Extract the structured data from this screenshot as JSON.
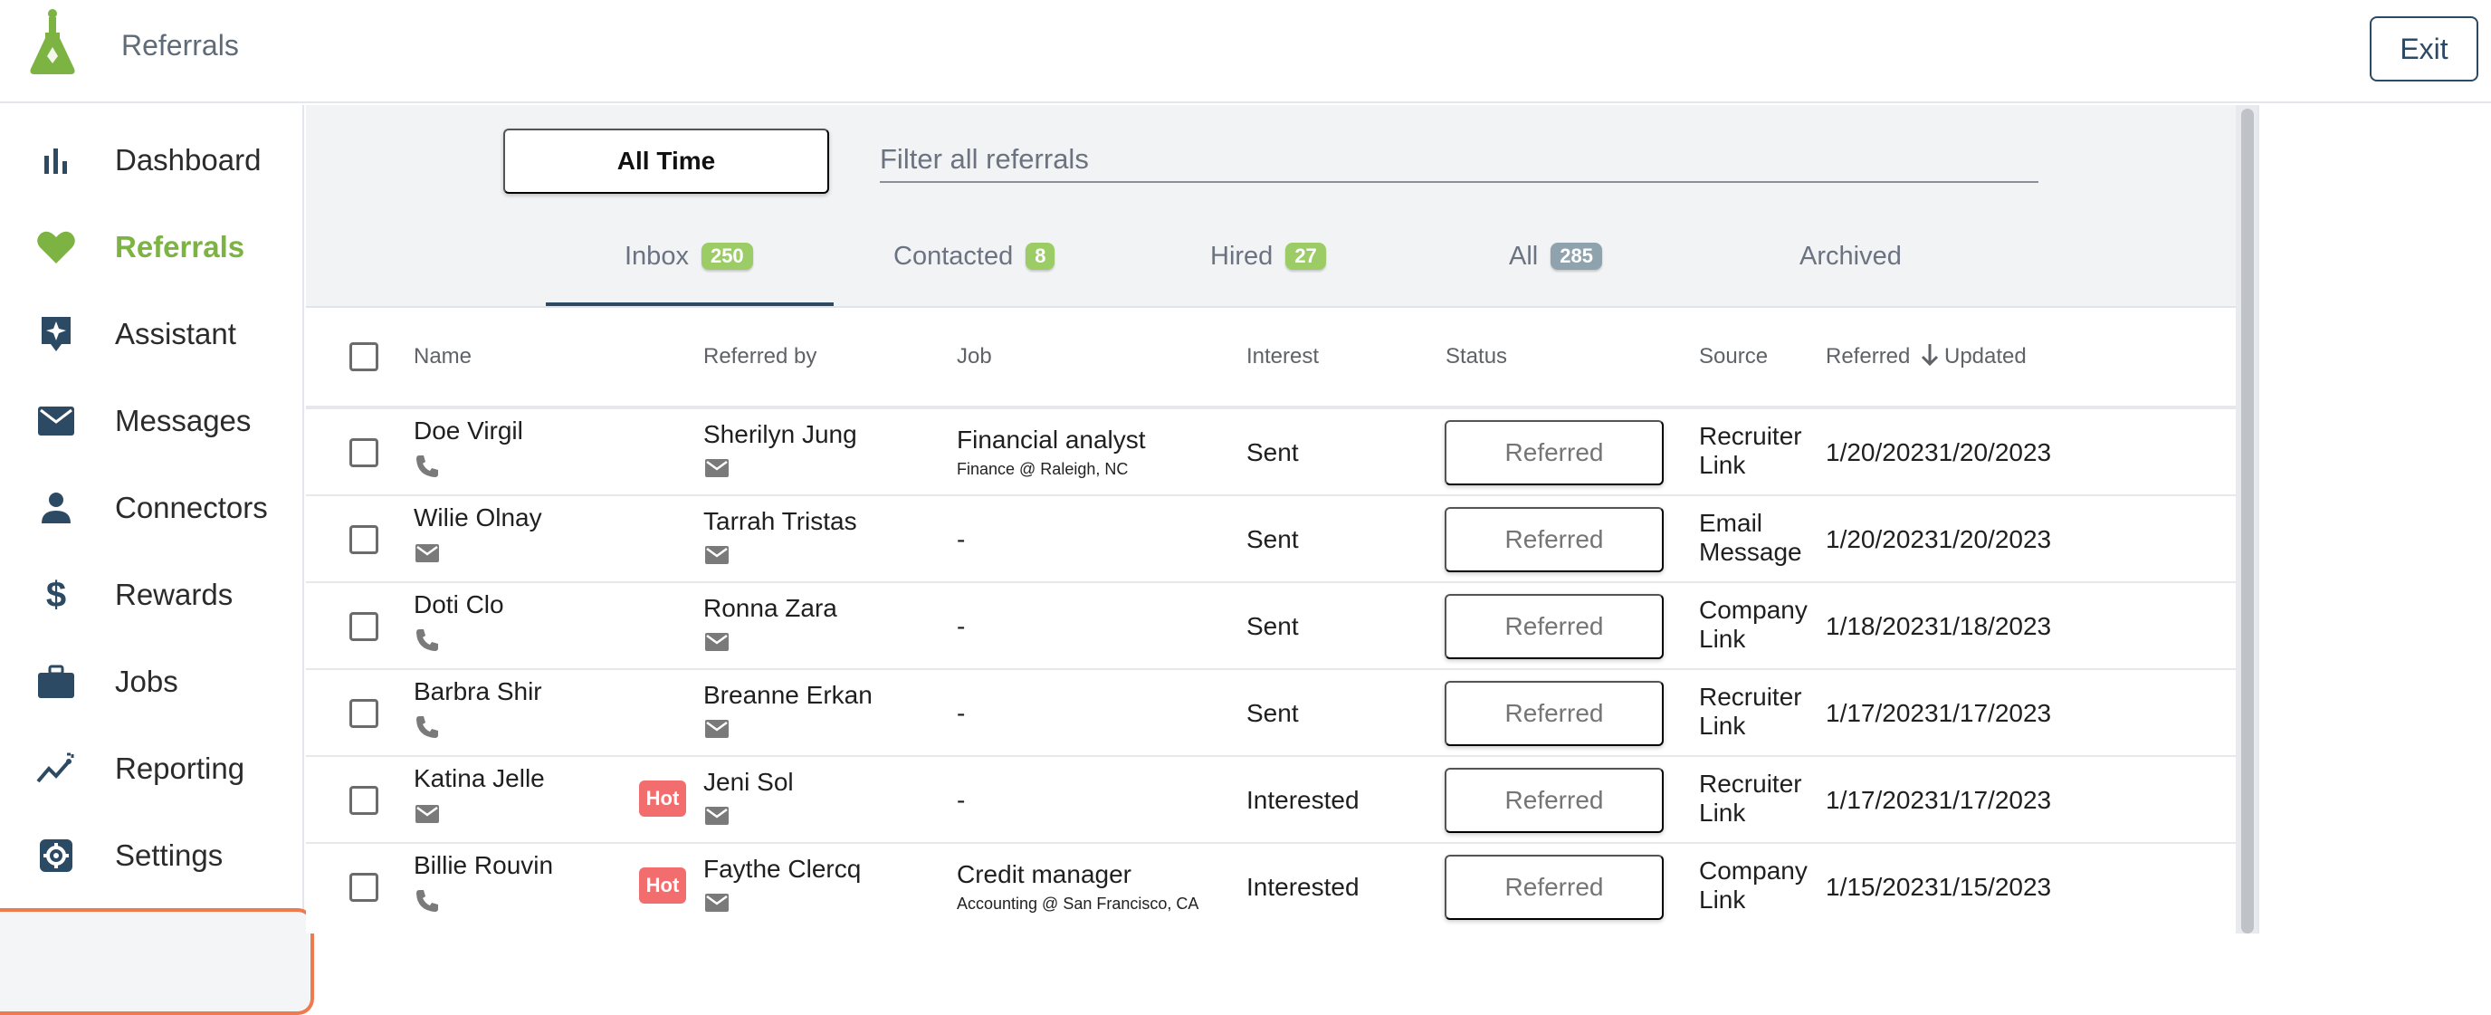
{
  "app": {
    "title": "Referrals",
    "exit_label": "Exit"
  },
  "colors": {
    "brand_green": "#7cb342",
    "navy": "#2c4a63",
    "hot_red": "#f26d6d",
    "highlight_orange": "#ef7a4e"
  },
  "sidebar": {
    "items": [
      {
        "label": "Dashboard",
        "icon": "bar-chart-icon"
      },
      {
        "label": "Referrals",
        "icon": "heart-icon",
        "active": true
      },
      {
        "label": "Assistant",
        "icon": "sparkle-icon"
      },
      {
        "label": "Messages",
        "icon": "envelope-icon"
      },
      {
        "label": "Connectors",
        "icon": "person-icon"
      },
      {
        "label": "Rewards",
        "icon": "dollar-icon"
      },
      {
        "label": "Jobs",
        "icon": "briefcase-icon"
      },
      {
        "label": "Reporting",
        "icon": "trend-icon"
      },
      {
        "label": "Settings",
        "icon": "gear-icon"
      }
    ]
  },
  "filters": {
    "time_label": "All Time",
    "search_placeholder": "Filter all referrals"
  },
  "tabs": [
    {
      "label": "Inbox",
      "count": "250"
    },
    {
      "label": "Contacted",
      "count": "8"
    },
    {
      "label": "Hired",
      "count": "27"
    },
    {
      "label": "All",
      "count": "285"
    },
    {
      "label": "Archived",
      "count": ""
    }
  ],
  "table": {
    "headers": {
      "name": "Name",
      "referred_by": "Referred by",
      "job": "Job",
      "interest": "Interest",
      "status": "Status",
      "source": "Source",
      "referred": "Referred",
      "updated": "Updated"
    },
    "rows": [
      {
        "name": "Doe Virgil",
        "contact_icon": "phone-icon",
        "hot": "",
        "referred_by": "Sherilyn Jung",
        "job_title": "Financial analyst",
        "job_detail": "Finance  @  Raleigh, NC",
        "interest": "Sent",
        "status": "Referred",
        "source_1": "Recruiter",
        "source_2": "Link",
        "dates": "1/20/20231/20/2023"
      },
      {
        "name": "Wilie Olnay",
        "contact_icon": "envelope-icon",
        "hot": "",
        "referred_by": "Tarrah Tristas",
        "job_title": "-",
        "job_detail": "",
        "interest": "Sent",
        "status": "Referred",
        "source_1": "Email",
        "source_2": "Message",
        "dates": "1/20/20231/20/2023"
      },
      {
        "name": "Doti Clo",
        "contact_icon": "phone-icon",
        "hot": "",
        "referred_by": "Ronna Zara",
        "job_title": "-",
        "job_detail": "",
        "interest": "Sent",
        "status": "Referred",
        "source_1": "Company",
        "source_2": "Link",
        "dates": "1/18/20231/18/2023"
      },
      {
        "name": "Barbra Shir",
        "contact_icon": "phone-icon",
        "hot": "",
        "referred_by": "Breanne Erkan",
        "job_title": "-",
        "job_detail": "",
        "interest": "Sent",
        "status": "Referred",
        "source_1": "Recruiter",
        "source_2": "Link",
        "dates": "1/17/20231/17/2023"
      },
      {
        "name": "Katina Jelle",
        "contact_icon": "envelope-icon",
        "hot": "Hot",
        "referred_by": "Jeni Sol",
        "job_title": "-",
        "job_detail": "",
        "interest": "Interested",
        "status": "Referred",
        "source_1": "Recruiter",
        "source_2": "Link",
        "dates": "1/17/20231/17/2023"
      },
      {
        "name": "Billie Rouvin",
        "contact_icon": "phone-icon",
        "hot": "Hot",
        "referred_by": "Faythe Clercq",
        "job_title": "Credit manager",
        "job_detail": "Accounting  @  San Francisco, CA",
        "interest": "Interested",
        "status": "Referred",
        "source_1": "Company",
        "source_2": "Link",
        "dates": "1/15/20231/15/2023"
      }
    ]
  }
}
